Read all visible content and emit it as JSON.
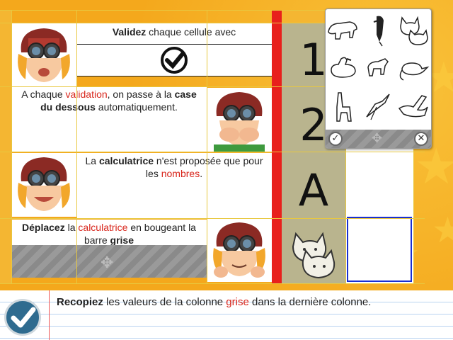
{
  "instructions": {
    "row1": {
      "bold": "Validez",
      "text": " chaque cellule avec"
    },
    "row2": {
      "p1": "A chaque ",
      "red": "validation",
      "p2": ", on passe à la ",
      "bold": "case du dessous",
      "p3": " automatiquement."
    },
    "row3": {
      "p1": "La ",
      "bold": "calculatrice",
      "p2": " n'est proposée que pour les ",
      "red": "nombres",
      "p3": "."
    },
    "row4": {
      "bold1": "Déplacez",
      "p1": " la ",
      "red": "calculatrice",
      "p2": " en bougeant la barre ",
      "bold2": "grise"
    }
  },
  "column_values": [
    "1",
    "2",
    "A"
  ],
  "bottom": {
    "bold": "Recopiez",
    "p1": " les valeurs de la colonne ",
    "red": "grise",
    "p2": " dans la dernière colonne."
  },
  "popup": {
    "animals": [
      "polar-bear-icon",
      "bird-icon",
      "cats-icon",
      "duck-icon",
      "goat-icon",
      "rat-icon",
      "llama-icon",
      "crane-icon",
      "swan-icon"
    ]
  },
  "colors": {
    "accent_red": "#d8261c",
    "background": "#f4a81c",
    "olive": "#b9b48e",
    "button": "#2f6b8f"
  }
}
